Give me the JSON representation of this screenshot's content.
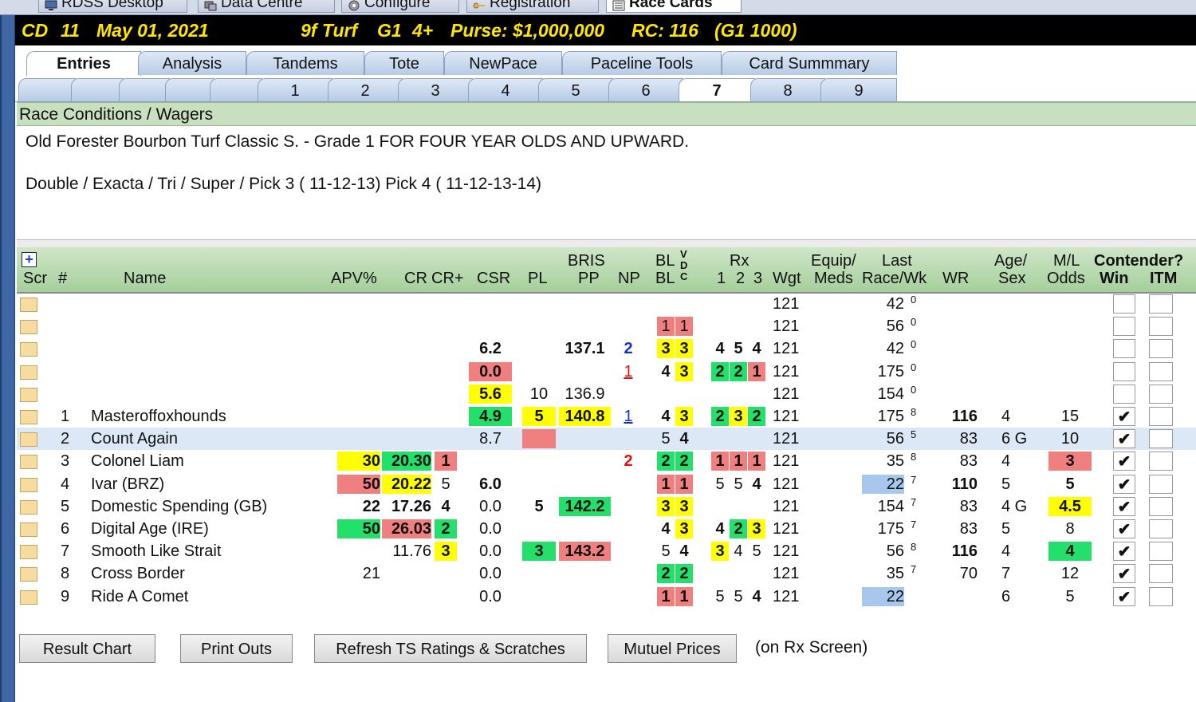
{
  "top_tabs": [
    {
      "label": "RDSS Desktop",
      "icon": "desktop-icon"
    },
    {
      "label": "Data Centre",
      "icon": "data-centre-icon"
    },
    {
      "label": "Configure",
      "icon": "gear-icon"
    },
    {
      "label": "Registration",
      "icon": "key-icon"
    },
    {
      "label": "Race Cards",
      "icon": "race-card-icon"
    }
  ],
  "race_header": {
    "track": "CD",
    "race": "11",
    "date": "May 01, 2021",
    "dist_surface": "9f Turf",
    "grade": "G1",
    "age": "4+",
    "purse": "Purse: $1,000,000",
    "rc": "RC: 116",
    "rc_grade": "(G1 1000)"
  },
  "main_tabs": [
    "Entries",
    "Analysis",
    "Tandems",
    "Tote",
    "NewPace",
    "Paceline Tools",
    "Card Summmary"
  ],
  "race_tabs": [
    "",
    "",
    "",
    "",
    "",
    "1",
    "2",
    "3",
    "4",
    "5",
    "6",
    "7",
    "8",
    "9"
  ],
  "conditions": {
    "header": "Race Conditions / Wagers",
    "line1": "Old Forester Bourbon Turf Classic S. - Grade 1 FOR FOUR YEAR OLDS AND UPWARD.",
    "line2": "Double / Exacta / Tri / Super / Pick 3 ( 11-12-13) Pick 4 ( 11-12-13-14)"
  },
  "grid_headers": {
    "scr": "Scr",
    "num": "#",
    "name": "Name",
    "apv": "APV%",
    "cr": "CR",
    "crplus": "CR+",
    "csr": "CSR",
    "pl": "PL",
    "bris1": "BRIS",
    "bris2": "PP",
    "np": "NP",
    "bl1": "BL",
    "bl2": "BL",
    "vdc1": "V",
    "vdc2": "D",
    "vdc3": "C",
    "rx": "Rx",
    "rx1": "1",
    "rx2": "2",
    "rx3": "3",
    "wgt": "Wgt",
    "equip1": "Equip/",
    "equip2": "Meds",
    "last1": "Last",
    "last2": "Race/Wk",
    "wr": "WR",
    "age1": "Age/",
    "age2": "Sex",
    "ml1": "M/L",
    "ml2": "Odds",
    "contender": "Contender?",
    "win": "Win",
    "itm": "ITM",
    "plus": "+"
  },
  "rows": [
    {
      "num": "",
      "name": "",
      "apv": "",
      "cr": "",
      "crp": "",
      "csr": "",
      "pl": "",
      "bris": "",
      "np": "",
      "bl1": "",
      "bl2": "",
      "rx": [
        "",
        "",
        ""
      ],
      "wgt": "121",
      "last": "42",
      "wk": "0",
      "wr": "",
      "age": "",
      "ml": "",
      "win": "",
      "itm": "",
      "c": {}
    },
    {
      "num": "",
      "name": "",
      "apv": "",
      "cr": "",
      "crp": "",
      "csr": "",
      "pl": "",
      "bris": "",
      "np": "",
      "bl1": "1",
      "bl2": "1",
      "rx": [
        "",
        "",
        ""
      ],
      "wgt": "121",
      "last": "56",
      "wk": "0",
      "wr": "",
      "age": "",
      "ml": "",
      "win": "",
      "itm": "",
      "c": {
        "bl1": "r",
        "bl2": "r"
      }
    },
    {
      "num": "",
      "name": "",
      "apv": "",
      "cr": "",
      "crp": "",
      "csr": "6.2",
      "pl": "",
      "bris": "137.1",
      "np": "2",
      "bl1": "3",
      "bl2": "3",
      "rx": [
        "4",
        "5",
        "4"
      ],
      "wgt": "121",
      "last": "42",
      "wk": "0",
      "wr": "",
      "age": "",
      "ml": "",
      "win": "",
      "itm": "",
      "c": {
        "bl1": "y",
        "bl2": "y"
      },
      "bold": [
        "csr",
        "bris",
        "np",
        "bl1",
        "bl2",
        "rx"
      ],
      "npcls": "blue"
    },
    {
      "num": "",
      "name": "",
      "apv": "",
      "cr": "",
      "crp": "",
      "csr": "0.0",
      "pl": "",
      "bris": "",
      "np": "1",
      "bl1": "4",
      "bl2": "3",
      "rx": [
        "2",
        "2",
        "1"
      ],
      "wgt": "121",
      "last": "175",
      "wk": "0",
      "wr": "",
      "age": "",
      "ml": "",
      "win": "",
      "itm": "",
      "c": {
        "csr": "r",
        "bl2": "y",
        "rx0": "g",
        "rx1": "g",
        "rx2": "r"
      },
      "bold": [
        "csr",
        "bl1",
        "bl2",
        "rx"
      ],
      "npcls": "red ul"
    },
    {
      "num": "",
      "name": "",
      "apv": "",
      "cr": "",
      "crp": "",
      "csr": "5.6",
      "pl": "10",
      "bris": "136.9",
      "np": "",
      "bl1": "",
      "bl2": "",
      "rx": [
        "",
        "",
        ""
      ],
      "wgt": "121",
      "last": "154",
      "wk": "0",
      "wr": "",
      "age": "",
      "ml": "",
      "win": "",
      "itm": "",
      "c": {
        "csr": "y"
      },
      "bold": [
        "csr"
      ]
    },
    {
      "num": "1",
      "name": "Masteroffoxhounds",
      "apv": "",
      "cr": "",
      "crp": "",
      "csr": "4.9",
      "pl": "5",
      "bris": "140.8",
      "np": "1",
      "bl1": "4",
      "bl2": "3",
      "rx": [
        "2",
        "3",
        "2"
      ],
      "wgt": "121",
      "last": "175",
      "wk": "8",
      "wr": "116",
      "age": "4",
      "ml": "15",
      "win": "✔",
      "itm": "",
      "c": {
        "csr": "g",
        "pl": "y",
        "bris": "y",
        "bl2": "y",
        "rx0": "g",
        "rx1": "y",
        "rx2": "g"
      },
      "bold": [
        "csr",
        "pl",
        "bris",
        "bl1",
        "bl2",
        "rx",
        "wr"
      ],
      "npcls": "blue ul"
    },
    {
      "num": "2",
      "name": "Count Again",
      "apv": "",
      "cr": "",
      "crp": "",
      "csr": "8.7",
      "pl": " ",
      "bris": "",
      "np": "",
      "bl1": "5",
      "bl2": "4",
      "rx": [
        "",
        "",
        ""
      ],
      "wgt": "121",
      "last": "56",
      "wk": "5",
      "wr": "83",
      "age": "6 G",
      "ml": "10",
      "win": "✔",
      "itm": "",
      "c": {
        "pl": "r"
      },
      "bold": [
        "bl2"
      ],
      "sel": true
    },
    {
      "num": "3",
      "name": "Colonel Liam",
      "apv": "30",
      "cr": "20.30",
      "crp": "1",
      "csr": "",
      "pl": "",
      "bris": "",
      "np": "2",
      "bl1": "2",
      "bl2": "2",
      "rx": [
        "1",
        "1",
        "1"
      ],
      "wgt": "121",
      "last": "35",
      "wk": "8",
      "wr": "83",
      "age": "4",
      "ml": "3",
      "win": "✔",
      "itm": "",
      "c": {
        "apv": "y",
        "cr": "g",
        "crp": "r",
        "bl1": "g",
        "bl2": "g",
        "rx0": "r",
        "rx1": "r",
        "rx2": "r",
        "ml": "r"
      },
      "bold": [
        "apv",
        "cr",
        "crp",
        "np",
        "bl1",
        "bl2",
        "rx",
        "ml"
      ],
      "npcls": "red"
    },
    {
      "num": "4",
      "name": "Ivar (BRZ)",
      "apv": "50",
      "cr": "20.22",
      "crp": "5",
      "csr": "6.0",
      "pl": "",
      "bris": "",
      "np": "",
      "bl1": "1",
      "bl2": "1",
      "rx": [
        "5",
        "5",
        "4"
      ],
      "wgt": "121",
      "last": "22",
      "wk": "7",
      "wr": "110",
      "age": "5",
      "ml": "5",
      "win": "✔",
      "itm": "",
      "c": {
        "apv": "r",
        "cr": "y",
        "bl1": "r",
        "bl2": "r",
        "last": "lb"
      },
      "bold": [
        "apv",
        "cr",
        "csr",
        "bl1",
        "bl2",
        "rx2",
        "wr",
        "ml"
      ]
    },
    {
      "num": "5",
      "name": "Domestic Spending (GB)",
      "apv": "22",
      "cr": "17.26",
      "crp": "4",
      "csr": "0.0",
      "pl": "5",
      "bris": "142.2",
      "np": "",
      "bl1": "3",
      "bl2": "3",
      "rx": [
        "",
        "",
        ""
      ],
      "wgt": "121",
      "last": "154",
      "wk": "7",
      "wr": "83",
      "age": "4 G",
      "ml": "4.5",
      "win": "✔",
      "itm": "",
      "c": {
        "bris": "g",
        "bl1": "y",
        "bl2": "y",
        "ml": "y"
      },
      "bold": [
        "apv",
        "cr",
        "crp",
        "pl",
        "bris",
        "bl1",
        "bl2",
        "ml"
      ]
    },
    {
      "num": "6",
      "name": "Digital Age (IRE)",
      "apv": "50",
      "cr": "26.03",
      "crp": "2",
      "csr": "0.0",
      "pl": "",
      "bris": "",
      "np": "",
      "bl1": "4",
      "bl2": "3",
      "rx": [
        "4",
        "2",
        "3"
      ],
      "wgt": "121",
      "last": "175",
      "wk": "7",
      "wr": "83",
      "age": "5",
      "ml": "8",
      "win": "✔",
      "itm": "",
      "c": {
        "apv": "g",
        "cr": "r",
        "crp": "g",
        "bl2": "y",
        "rx1": "g",
        "rx2": "y"
      },
      "bold": [
        "apv",
        "cr",
        "crp",
        "bl1",
        "bl2",
        "rx"
      ]
    },
    {
      "num": "7",
      "name": "Smooth Like Strait",
      "apv": "",
      "cr": "11.76",
      "crp": "3",
      "csr": "0.0",
      "pl": "3",
      "bris": "143.2",
      "np": "",
      "bl1": "5",
      "bl2": "4",
      "rx": [
        "3",
        "4",
        "5"
      ],
      "wgt": "121",
      "last": "56",
      "wk": "8",
      "wr": "116",
      "age": "4",
      "ml": "4",
      "win": "✔",
      "itm": "",
      "c": {
        "crp": "y",
        "pl": "g",
        "bris": "r",
        "rx0": "y",
        "ml": "g"
      },
      "bold": [
        "crp",
        "pl",
        "bris",
        "bl2",
        "rx0",
        "wr",
        "ml"
      ]
    },
    {
      "num": "8",
      "name": "Cross Border",
      "apv": "21",
      "cr": "",
      "crp": "",
      "csr": "0.0",
      "pl": "",
      "bris": "",
      "np": "",
      "bl1": "2",
      "bl2": "2",
      "rx": [
        "",
        "",
        ""
      ],
      "wgt": "121",
      "last": "35",
      "wk": "7",
      "wr": "70",
      "age": "7",
      "ml": "12",
      "win": "✔",
      "itm": "",
      "c": {
        "bl1": "g",
        "bl2": "g"
      },
      "bold": [
        "bl1",
        "bl2"
      ]
    },
    {
      "num": "9",
      "name": "Ride A Comet",
      "apv": "",
      "cr": "",
      "crp": "",
      "csr": "0.0",
      "pl": "",
      "bris": "",
      "np": "",
      "bl1": "1",
      "bl2": "1",
      "rx": [
        "5",
        "5",
        "4"
      ],
      "wgt": "121",
      "last": "22",
      "wk": "",
      "wr": "",
      "age": "6",
      "ml": "5",
      "win": "✔",
      "itm": "",
      "c": {
        "bl1": "r",
        "bl2": "r",
        "last": "lb"
      },
      "bold": [
        "bl1",
        "bl2",
        "rx2"
      ]
    }
  ],
  "buttons": {
    "result_chart": "Result Chart",
    "print_outs": "Print Outs",
    "refresh": "Refresh TS Ratings & Scratches",
    "mutuel": "Mutuel Prices",
    "note": "(on Rx Screen)"
  },
  "colors": {
    "yellow": "#ffff00",
    "green": "#22e06a",
    "red": "#f08080",
    "light_blue": "#a7c7ec",
    "header_yellow": "#ffe600"
  }
}
